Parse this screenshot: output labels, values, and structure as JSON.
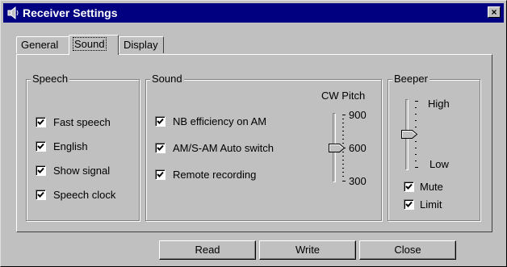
{
  "window": {
    "title": "Receiver Settings",
    "close_glyph": "×"
  },
  "tabs": [
    {
      "label": "General",
      "active": false
    },
    {
      "label": "Sound",
      "active": true
    },
    {
      "label": "Display",
      "active": false
    }
  ],
  "speech": {
    "title": "Speech",
    "items": [
      {
        "label": "Fast speech",
        "checked": true
      },
      {
        "label": "English",
        "checked": true
      },
      {
        "label": "Show signal",
        "checked": true
      },
      {
        "label": "Speech clock",
        "checked": true
      }
    ]
  },
  "sound": {
    "title": "Sound",
    "items": [
      {
        "label": "NB efficiency on AM",
        "checked": true
      },
      {
        "label": "AM/S-AM Auto switch",
        "checked": true
      },
      {
        "label": "Remote recording",
        "checked": true
      }
    ],
    "cw_pitch": {
      "label": "CW Pitch",
      "ticks": [
        "900",
        "600",
        "300"
      ],
      "min": 300,
      "max": 900,
      "value": 600
    }
  },
  "beeper": {
    "title": "Beeper",
    "high_label": "High",
    "low_label": "Low",
    "level": 0.5,
    "items": [
      {
        "label": "Mute",
        "checked": true
      },
      {
        "label": "Limit",
        "checked": true
      }
    ]
  },
  "buttons": {
    "read": "Read",
    "write": "Write",
    "close": "Close"
  },
  "icons": {
    "app": "speaker-icon",
    "close": "close-icon",
    "check": "check-icon"
  },
  "colors": {
    "titlebar": "#000080",
    "face": "#c0c0c0"
  }
}
